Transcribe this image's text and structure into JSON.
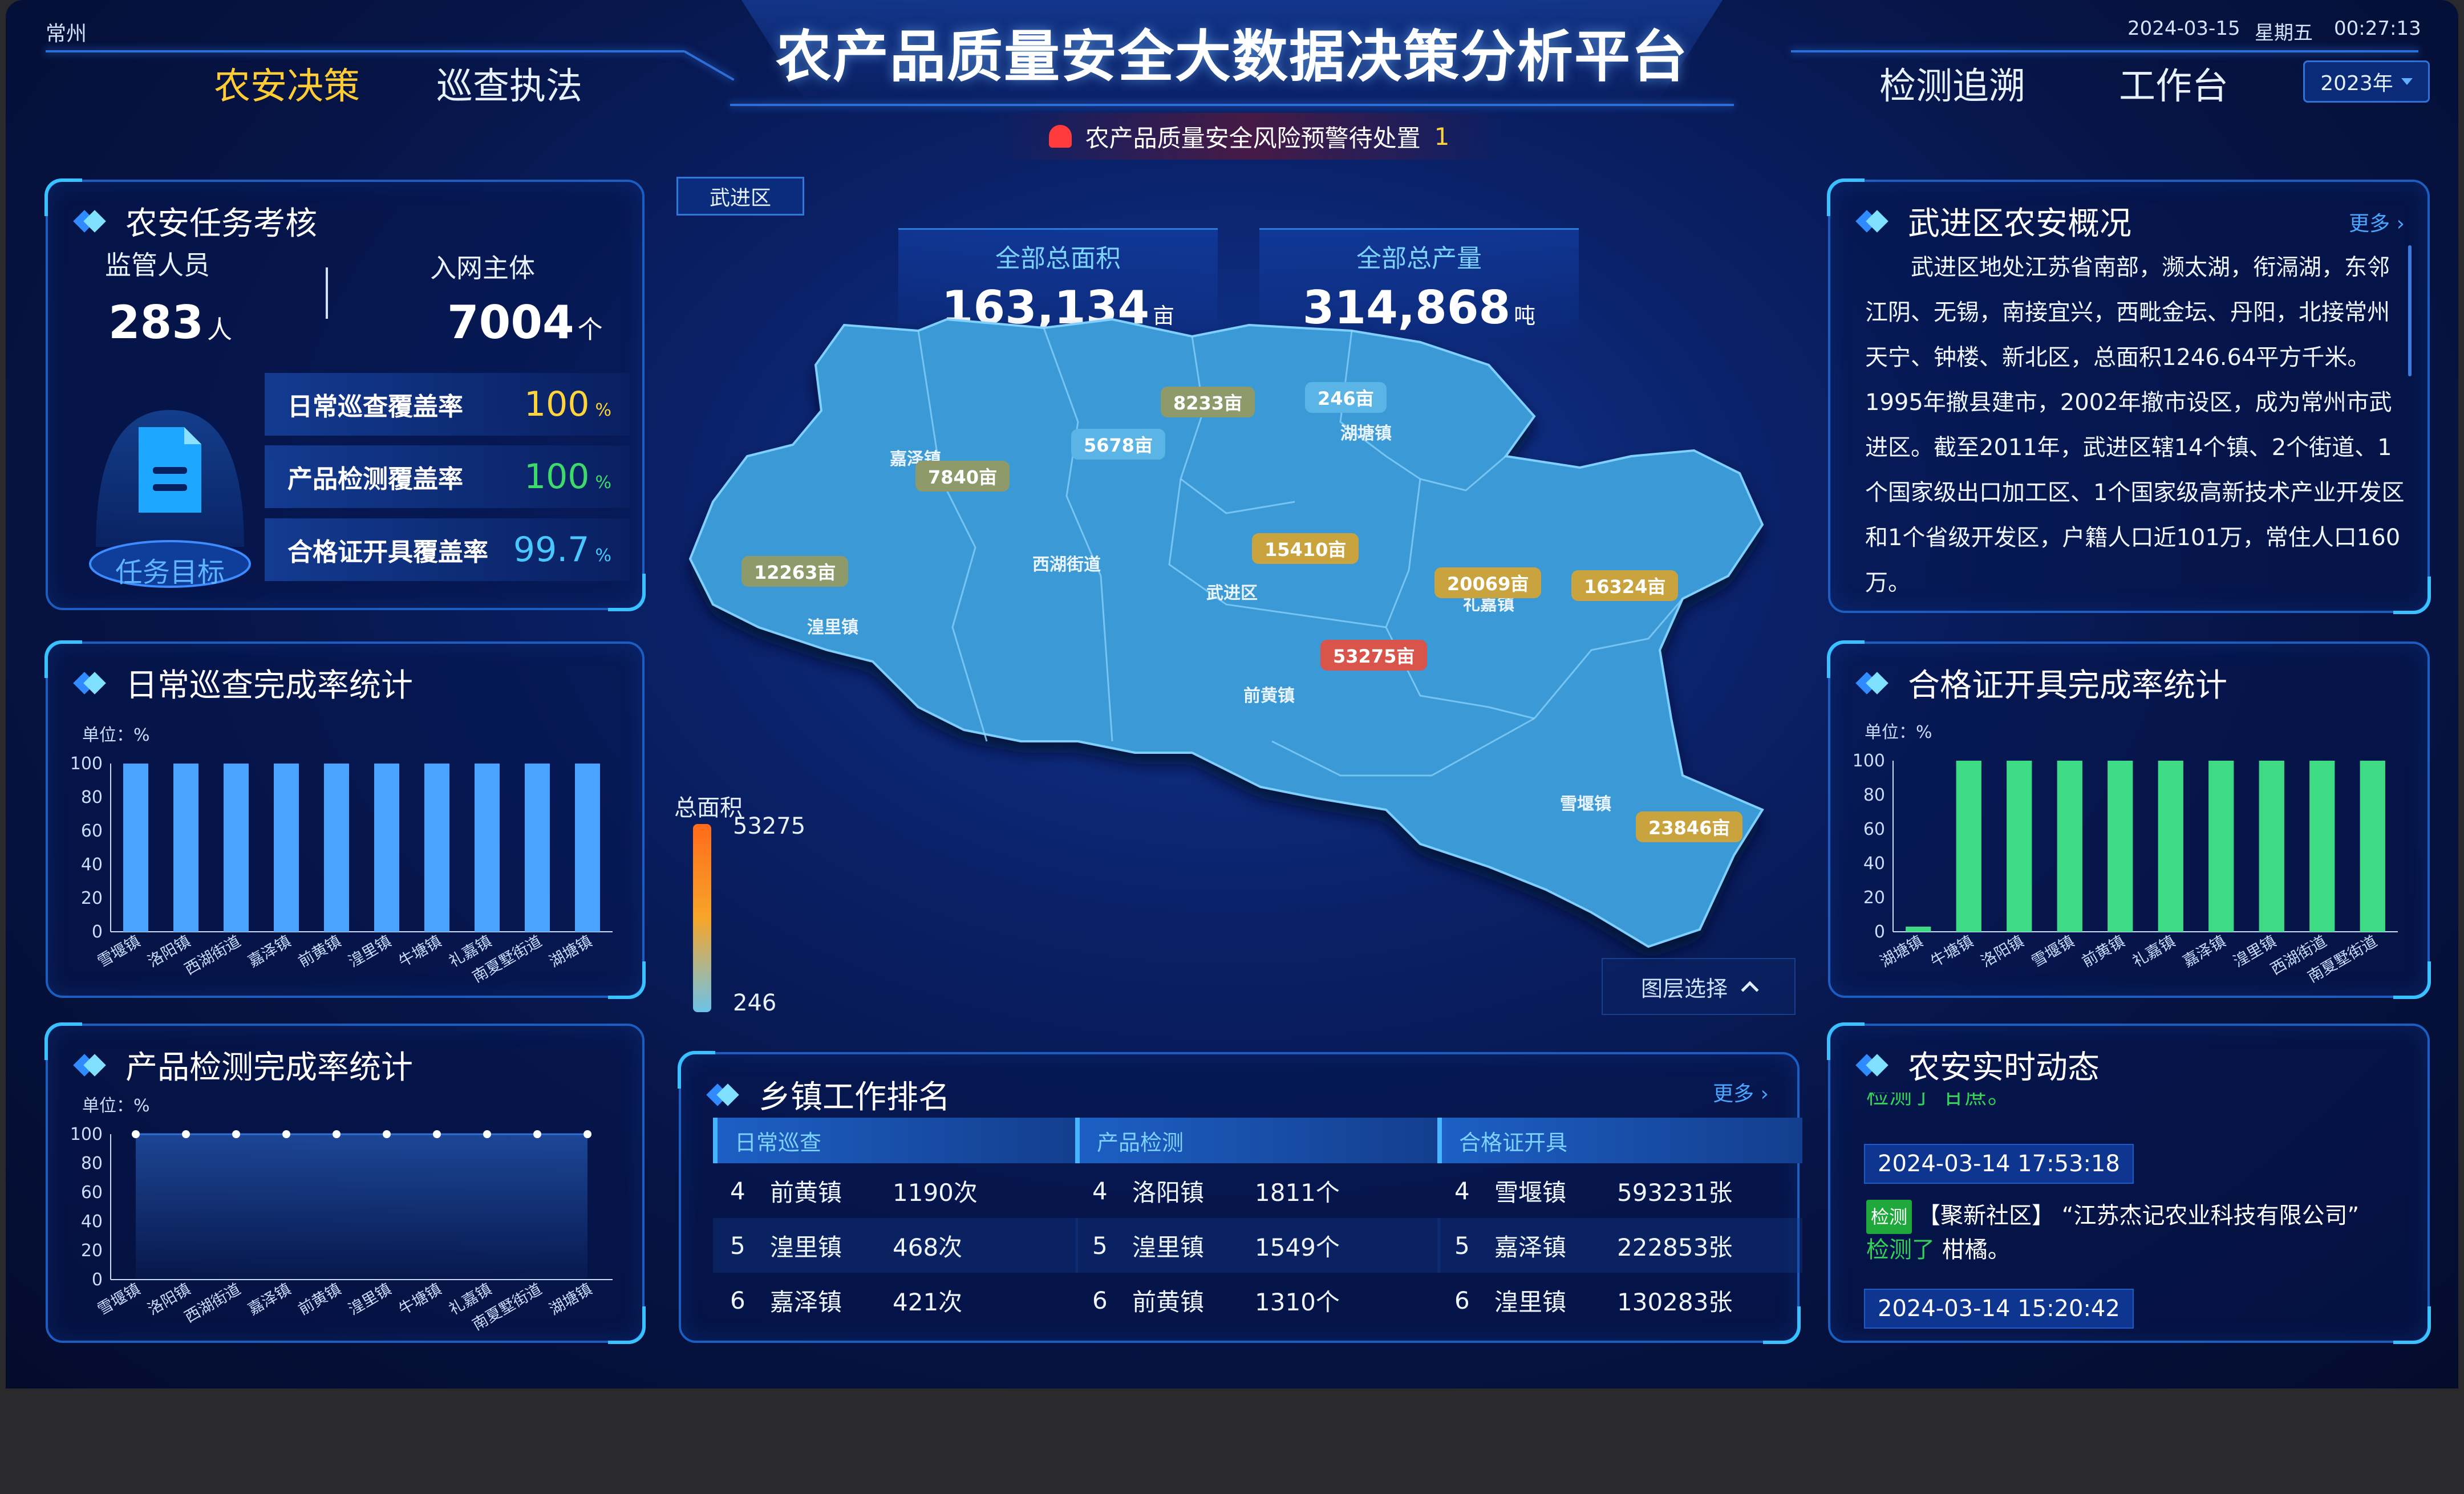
{
  "header": {
    "city": "常州",
    "title": "农产品质量安全大数据决策分析平台",
    "date": "2024-03-15",
    "weekday": "星期五",
    "time": "00:27:13",
    "nav_left": [
      "农安决策",
      "巡查执法"
    ],
    "nav_right": [
      "检测追溯",
      "工作台"
    ],
    "year": "2023年",
    "alert_text": "农产品质量安全风险预警待处置",
    "alert_count": "1"
  },
  "assessment": {
    "title": "农安任务考核",
    "staff_label": "监管人员",
    "staff_value": "283",
    "staff_unit": "人",
    "entity_label": "入网主体",
    "entity_value": "7004",
    "entity_unit": "个",
    "task_label": "任务目标",
    "rates": [
      {
        "label": "日常巡查覆盖率",
        "value": "100",
        "unit": "%",
        "color": "#ffd43b"
      },
      {
        "label": "产品检测覆盖率",
        "value": "100",
        "unit": "%",
        "color": "#3ddc6a"
      },
      {
        "label": "合格证开具覆盖率",
        "value": "99.7",
        "unit": "%",
        "color": "#49c8ff"
      }
    ]
  },
  "patrol_chart": {
    "title": "日常巡查完成率统计",
    "chart_data": {
      "type": "bar",
      "unit_label": "单位：%",
      "categories": [
        "雪堰镇",
        "洛阳镇",
        "西湖街道",
        "嘉泽镇",
        "前黄镇",
        "湟里镇",
        "牛塘镇",
        "礼嘉镇",
        "南夏墅街道",
        "湖塘镇"
      ],
      "values": [
        100,
        100,
        100,
        100,
        100,
        100,
        100,
        100,
        100,
        100
      ],
      "yticks": [
        0,
        20,
        40,
        60,
        80,
        100
      ],
      "ylim": [
        0,
        100
      ],
      "color": "#4aa3ff"
    }
  },
  "product_chart": {
    "title": "产品检测完成率统计",
    "chart_data": {
      "type": "area",
      "unit_label": "单位：%",
      "categories": [
        "雪堰镇",
        "洛阳镇",
        "西湖街道",
        "嘉泽镇",
        "前黄镇",
        "湟里镇",
        "牛塘镇",
        "礼嘉镇",
        "南夏墅街道",
        "湖塘镇"
      ],
      "values": [
        100,
        100,
        100,
        100,
        100,
        100,
        100,
        100,
        100,
        100
      ],
      "yticks": [
        0,
        20,
        40,
        60,
        80,
        100
      ],
      "ylim": [
        0,
        100
      ],
      "color": "#2f6fd6"
    }
  },
  "certificate_chart": {
    "title": "合格证开具完成率统计",
    "chart_data": {
      "type": "bar",
      "unit_label": "单位：%",
      "categories": [
        "湖塘镇",
        "牛塘镇",
        "洛阳镇",
        "雪堰镇",
        "前黄镇",
        "礼嘉镇",
        "嘉泽镇",
        "湟里镇",
        "西湖街道",
        "南夏墅街道"
      ],
      "values": [
        3,
        100,
        100,
        100,
        100,
        100,
        100,
        100,
        100,
        100
      ],
      "yticks": [
        0,
        20,
        40,
        60,
        80,
        100
      ],
      "ylim": [
        0,
        100
      ],
      "color": "#3ddc84"
    }
  },
  "map": {
    "district_tag": "武进区",
    "total_area_label": "全部总面积",
    "total_area_value": "163,134",
    "total_area_unit": "亩",
    "total_output_label": "全部总产量",
    "total_output_value": "314,868",
    "total_output_unit": "吨",
    "legend_title": "总面积",
    "legend_max": "53275",
    "legend_min": "246",
    "layer_select": "图层选择",
    "region_labels": [
      "嘉泽镇",
      "西湖街道",
      "湖塘镇",
      "武进区",
      "前黄镇",
      "湟里镇",
      "雪堰镇",
      "礼嘉镇"
    ],
    "pills": [
      "7840亩",
      "5678亩",
      "8233亩",
      "246亩",
      "12263亩",
      "15410亩",
      "20069亩",
      "16324亩",
      "53275亩",
      "23846亩"
    ]
  },
  "ranking": {
    "title": "乡镇工作排名",
    "more": "更多",
    "columns": [
      {
        "head": "日常巡查",
        "rows": [
          [
            "4",
            "前黄镇",
            "1190次"
          ],
          [
            "5",
            "湟里镇",
            "468次"
          ],
          [
            "6",
            "嘉泽镇",
            "421次"
          ]
        ]
      },
      {
        "head": "产品检测",
        "rows": [
          [
            "4",
            "洛阳镇",
            "1811个"
          ],
          [
            "5",
            "湟里镇",
            "1549个"
          ],
          [
            "6",
            "前黄镇",
            "1310个"
          ]
        ]
      },
      {
        "head": "合格证开具",
        "rows": [
          [
            "4",
            "雪堰镇",
            "593231张"
          ],
          [
            "5",
            "嘉泽镇",
            "222853张"
          ],
          [
            "6",
            "湟里镇",
            "130283张"
          ]
        ]
      }
    ]
  },
  "overview": {
    "title": "武进区农安概况",
    "more": "更多",
    "text": "武进区地处江苏省南部，濒太湖，衔滆湖，东邻江阴、无锡，南接宜兴，西毗金坛、丹阳，北接常州天宁、钟楼、新北区，总面积1246.64平方千米。1995年撤县建市，2002年撤市设区，成为常州市武进区。截至2011年，武进区辖14个镇、2个街道、1个国家级出口加工区、1个国家级高新技术产业开发区和1个省级开发区，户籍人口近101万，常住人口160万。"
  },
  "realtime": {
    "title": "农安实时动态",
    "partial_line": "检测了 甘蔗。",
    "time1": "2024-03-14 17:53:18",
    "tag": "检测",
    "entry_prefix": "【聚新社区】",
    "entry_company": "“江苏杰记农业科技有限公司”",
    "entry_action": "检测了",
    "entry_item": "柑橘。",
    "time2": "2024-03-14 15:20:42"
  }
}
